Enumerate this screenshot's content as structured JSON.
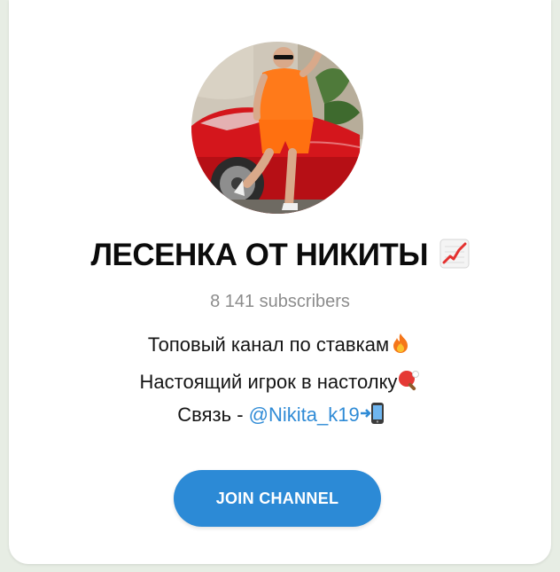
{
  "channel": {
    "title": "ЛЕСЕНКА ОТ НИКИТЫ",
    "title_emoji": "chart-increasing-icon",
    "subscribers": "8 141 subscribers",
    "description": {
      "line1": "Топовый канал по ставкам",
      "line1_emoji": "fire-icon",
      "line2": "Настоящий игрок в настолку",
      "line2_emoji": "ping-pong-icon",
      "line3_prefix": "Связь - ",
      "line3_link": "@Nikita_k19",
      "line3_emoji": "mobile-phone-arrow-icon"
    }
  },
  "actions": {
    "join_label": "JOIN CHANNEL"
  },
  "colors": {
    "accent": "#2c8ad6",
    "link": "#2f8bd6",
    "background": "#e7ede4"
  }
}
